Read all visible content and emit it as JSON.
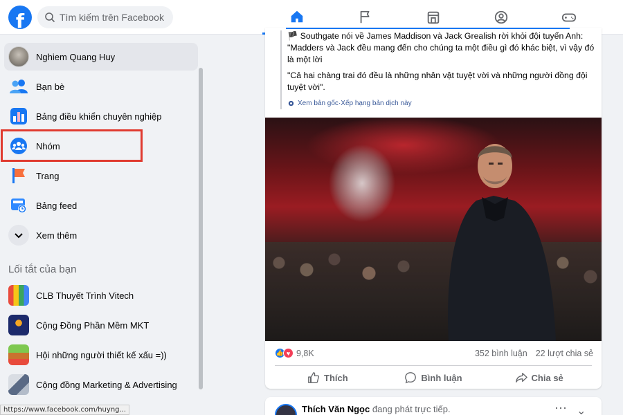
{
  "header": {
    "logo_letter": "f",
    "search_placeholder": "Tìm kiếm trên Facebook",
    "nav": [
      "home-icon",
      "pages-flag-icon",
      "marketplace-icon",
      "groups-icon",
      "gaming-icon"
    ],
    "brand_color": "#1877f2"
  },
  "sidebar": {
    "items": [
      {
        "label": "Nghiem Quang Huy",
        "icon": "profile-avatar"
      },
      {
        "label": "Bạn bè",
        "icon": "friends-icon"
      },
      {
        "label": "Bảng điều khiển chuyên nghiệp",
        "icon": "dashboard-icon"
      },
      {
        "label": "Nhóm",
        "icon": "groups-icon"
      },
      {
        "label": "Trang",
        "icon": "flag-icon"
      },
      {
        "label": "Bảng feed",
        "icon": "feed-icon"
      },
      {
        "label": "Xem thêm",
        "icon": "chevron-down-icon"
      }
    ],
    "shortcuts_title": "Lối tắt của bạn",
    "shortcuts": [
      {
        "label": "CLB Thuyết Trình Vitech"
      },
      {
        "label": "Cộng Đồng Phần Mềm MKT"
      },
      {
        "label": "Hội những người thiết kế xấu =))"
      },
      {
        "label": "Cộng đồng Marketing & Advertising"
      }
    ],
    "highlight_color": "#e03a2f"
  },
  "status_bar": {
    "url": "https://www.facebook.com/huyng..."
  },
  "post": {
    "quote_line1": "🏴 Southgate nói về James Maddison và Jack Grealish rời khỏi đội tuyển Anh: \"Madders và Jack đều mang đến cho chúng ta một điều gì đó khác biệt, vì vậy đó là một lời",
    "quote_line2": "\"Cả hai chàng trai đó đều là những nhân vật tuyệt vời và những người đồng đội tuyệt vời\".",
    "see_original": "Xem bản gốc",
    "separator": " · ",
    "rate_translation": "Xếp hạng bản dịch này",
    "reaction_count": "9,8K",
    "comments": "352 bình luận",
    "shares": "22 lượt chia sẻ",
    "actions": {
      "like": "Thích",
      "comment": "Bình luận",
      "share": "Chia sẻ"
    }
  },
  "next_post": {
    "author": "Thích Văn Ngọc",
    "status": "đang phát trực tiếp."
  }
}
